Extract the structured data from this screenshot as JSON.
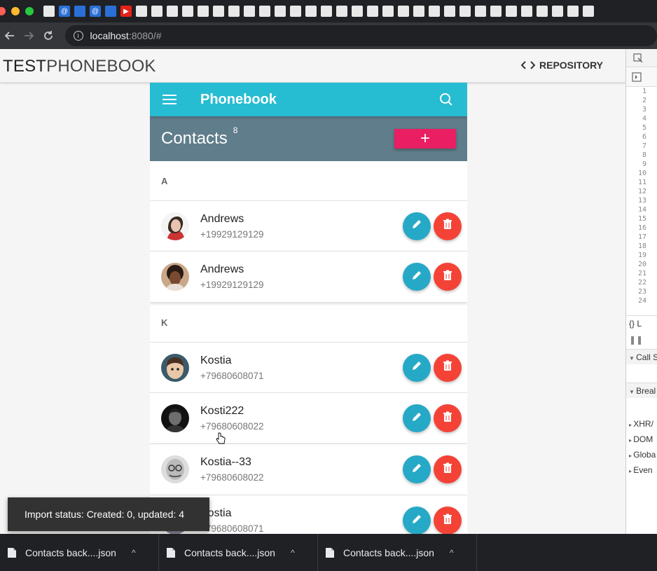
{
  "browser": {
    "url_host": "localhost",
    "url_path": ":8080/#"
  },
  "header": {
    "brand_bold": "TEST",
    "brand_light": "PHONEBOOK",
    "repo_label": "REPOSITORY"
  },
  "app": {
    "title": "Phonebook",
    "contacts_label": "Contacts",
    "contacts_count": "8",
    "add_label": "+"
  },
  "groups": [
    {
      "letter": "A",
      "contacts": [
        {
          "name": "Andrews",
          "phone": "+19929129129"
        },
        {
          "name": "Andrews",
          "phone": "+19929129129"
        }
      ]
    },
    {
      "letter": "K",
      "contacts": [
        {
          "name": "Kostia",
          "phone": "+79680608071"
        },
        {
          "name": "Kosti222",
          "phone": "+79680608022"
        },
        {
          "name": "Kostia--33",
          "phone": "+79680608022"
        },
        {
          "name": "Kostia",
          "phone": "+79680608071"
        }
      ]
    }
  ],
  "toast": {
    "text": "Import status: Created: 0, updated: 4"
  },
  "downloads": [
    {
      "label": "Contacts back....json"
    },
    {
      "label": "Contacts back....json"
    },
    {
      "label": "Contacts back....json"
    }
  ],
  "devtools": {
    "lines": [
      "1",
      "2",
      "3",
      "4",
      "5",
      "6",
      "7",
      "8",
      "9",
      "10",
      "11",
      "12",
      "13",
      "14",
      "15",
      "16",
      "17",
      "18",
      "19",
      "20",
      "21",
      "22",
      "23",
      "24"
    ],
    "sections": [
      "Call S",
      "Breal",
      "XHR/",
      "DOM",
      "Globa",
      "Even"
    ]
  },
  "colors": {
    "appbar": "#26bcd2",
    "contacts_bar": "#607d8b",
    "add_button": "#e91e63",
    "edit_fab": "#26a9c6",
    "delete_fab": "#f44336"
  }
}
